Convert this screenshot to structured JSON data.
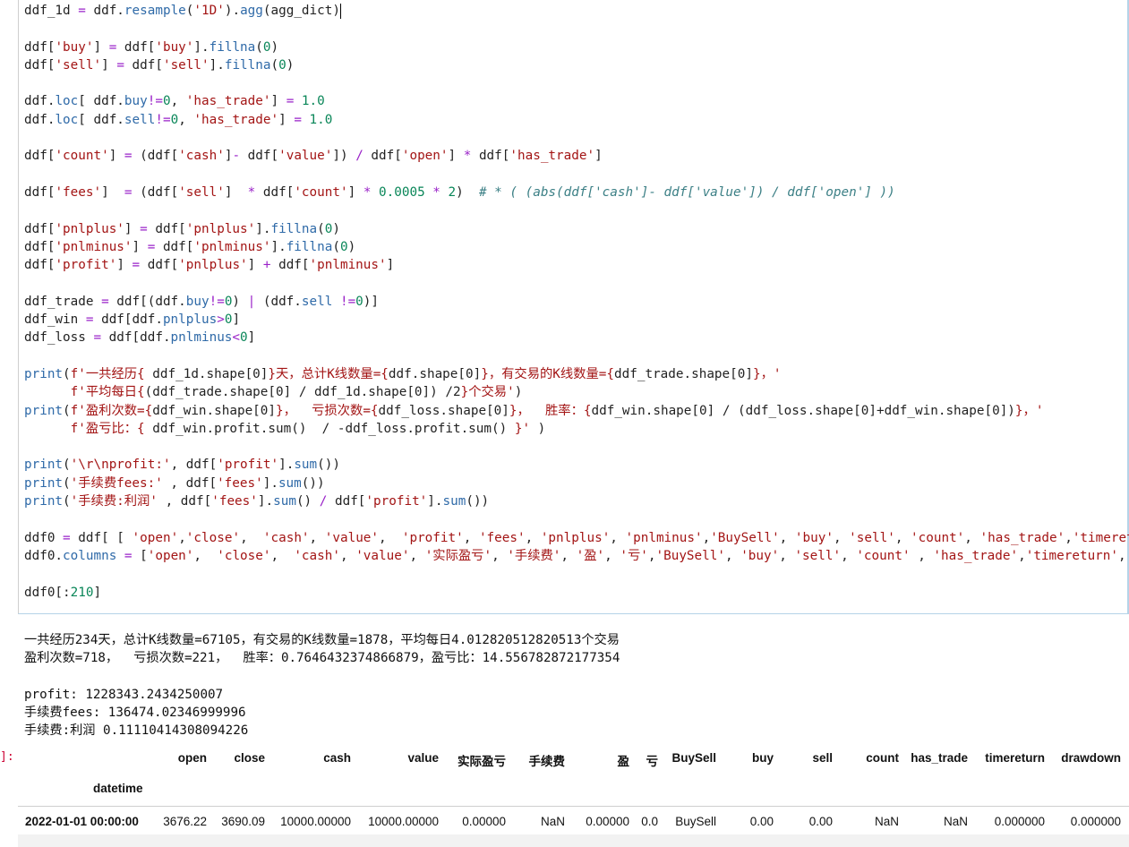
{
  "code_lines": [
    "ddf_1d = ddf.resample('1D').agg(agg_dict)",
    "",
    "ddf['buy'] = ddf['buy'].fillna(0)",
    "ddf['sell'] = ddf['sell'].fillna(0)",
    "",
    "ddf.loc[ ddf.buy!=0, 'has_trade'] = 1.0",
    "ddf.loc[ ddf.sell!=0, 'has_trade'] = 1.0",
    "",
    "ddf['count'] = (ddf['cash']- ddf['value']) / ddf['open'] * ddf['has_trade']",
    "",
    "ddf['fees']  = (ddf['sell']  * ddf['count'] * 0.0005 * 2)  # * ( (abs(ddf['cash']- ddf['value']) / ddf['open'] ))",
    "",
    "ddf['pnlplus'] = ddf['pnlplus'].fillna(0)",
    "ddf['pnlminus'] = ddf['pnlminus'].fillna(0)",
    "ddf['profit'] = ddf['pnlplus'] + ddf['pnlminus']",
    "",
    "ddf_trade = ddf[(ddf.buy!=0) | (ddf.sell !=0)]",
    "ddf_win = ddf[ddf.pnlplus>0]",
    "ddf_loss = ddf[ddf.pnlminus<0]",
    "",
    "print(f'一共经历{ ddf_1d.shape[0]}天，总计K线数量={ddf.shape[0]}，有交易的K线数量={ddf_trade.shape[0]}，'",
    "      f'平均每日{(ddf_trade.shape[0] / ddf_1d.shape[0]) /2}个交易')",
    "print(f'盈利次数={ddf_win.shape[0]}，  亏损次数={ddf_loss.shape[0]}，  胜率：{ddf_win.shape[0] / (ddf_loss.shape[0]+ddf_win.shape[0])}，'",
    "      f'盈亏比：{ ddf_win.profit.sum()  / -ddf_loss.profit.sum() }' )",
    "",
    "print('\\r\\nprofit:', ddf['profit'].sum())",
    "print('手续费fees:' , ddf['fees'].sum())",
    "print('手续费:利润' , ddf['fees'].sum() / ddf['profit'].sum())",
    "",
    "ddf0 = ddf[ [ 'open','close',  'cash', 'value',  'profit', 'fees', 'pnlplus', 'pnlminus','BuySell', 'buy', 'sell', 'count', 'has_trade','timereturn','drawdown']]",
    "ddf0.columns = ['open',  'close',  'cash', 'value', '实际盈亏', '手续费', '盈', '亏','BuySell', 'buy', 'sell', 'count' , 'has_trade','timereturn','drawdown']",
    "",
    "ddf0[:210]"
  ],
  "output": {
    "prompt": "]:",
    "stream_lines": [
      "一共经历234天，总计K线数量=67105，有交易的K线数量=1878，平均每日4.012820512820513个交易",
      "盈利次数=718，  亏损次数=221，  胜率：0.7646432374866879，盈亏比：14.556782872177354",
      "",
      "profit: 1228343.2434250007",
      "手续费fees: 136474.02346999996",
      "手续费:利润 0.11110414308094226"
    ],
    "table": {
      "columns": [
        "open",
        "close",
        "cash",
        "value",
        "实际盈亏",
        "手续费",
        "盈",
        "亏",
        "BuySell",
        "buy",
        "sell",
        "count",
        "has_trade",
        "timereturn",
        "drawdown"
      ],
      "index_name": "datetime",
      "rows": [
        {
          "index": "2022-01-01 00:00:00",
          "values": [
            "3676.22",
            "3690.09",
            "10000.00000",
            "10000.00000",
            "0.00000",
            "NaN",
            "0.00000",
            "0.0",
            "BuySell",
            "0.00",
            "0.00",
            "NaN",
            "NaN",
            "0.000000",
            "0.000000"
          ]
        }
      ]
    }
  }
}
